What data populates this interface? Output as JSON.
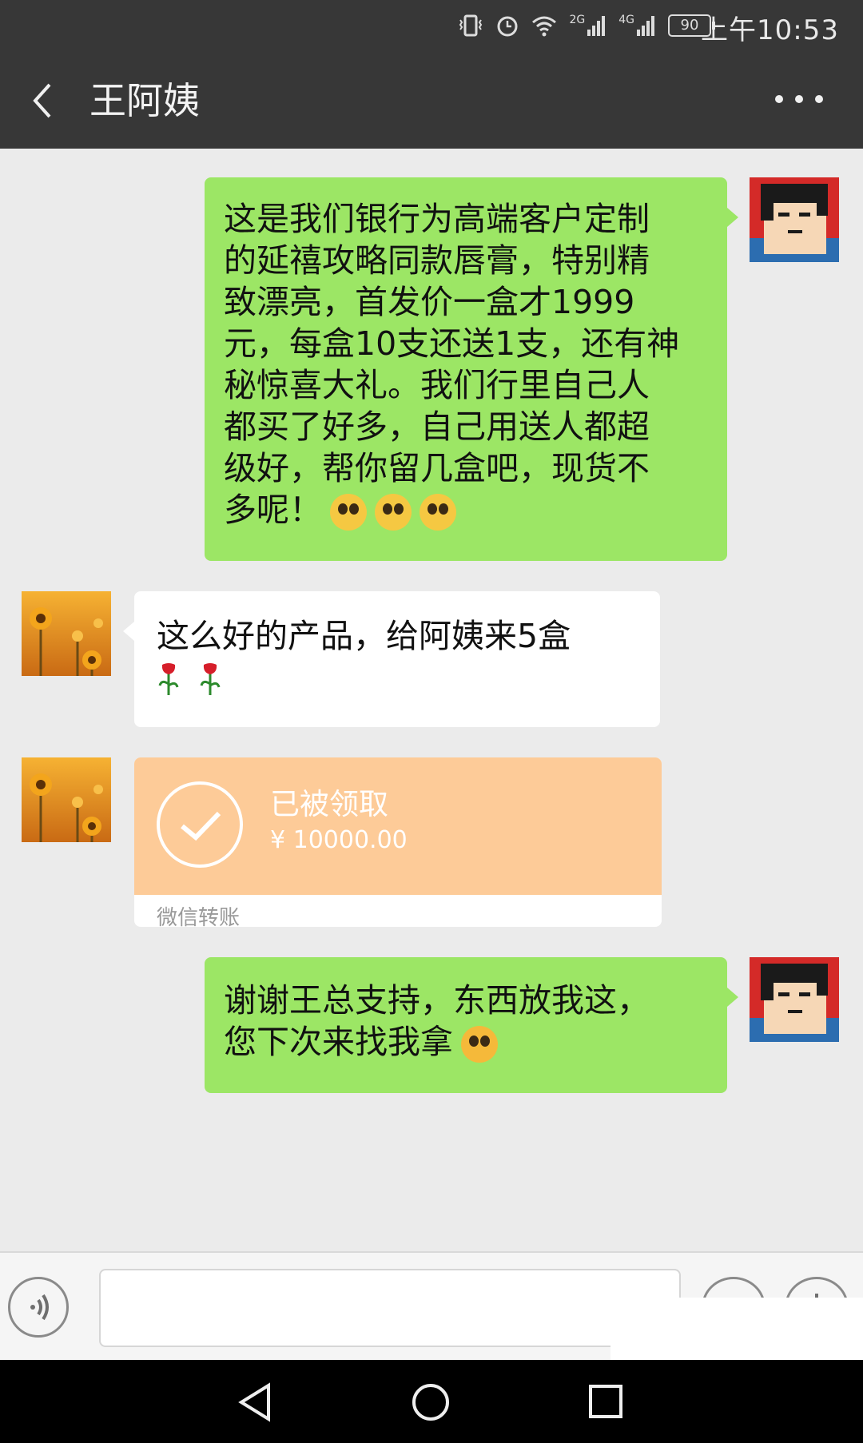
{
  "status_bar": {
    "signal_2g": "2G",
    "signal_4g": "4G",
    "battery": "90",
    "time": "上午10:53"
  },
  "header": {
    "title": "王阿姨"
  },
  "messages": [
    {
      "side": "right",
      "text": "这是我们银行为高端客户定制\n的延禧攻略同款唇膏，特别精\n致漂亮，首发价一盒才1999\n元，每盒10支还送1支，还有神\n秘惊喜大礼。我们行里自己人\n都买了好多，自己用送人都超\n级好，帮你留几盒吧，现货不\n多呢！",
      "emojis": [
        "happy-face-icon",
        "happy-face-icon",
        "happy-face-icon"
      ]
    },
    {
      "side": "left",
      "text": "这么好的产品，给阿姨来5盒",
      "emojis": [
        "rose-icon",
        "rose-icon"
      ]
    },
    {
      "side": "left",
      "type": "transfer",
      "status": "已被领取",
      "amount": "¥ 10000.00",
      "footer": "微信转账"
    },
    {
      "side": "right",
      "text": "谢谢王总支持，东西放我这，\n您下次来找我拿",
      "emojis": [
        "wink-tongue-face-icon"
      ]
    }
  ],
  "colors": {
    "header_bg": "#373737",
    "chat_bg": "#ebebeb",
    "sent_bubble": "#9ce665",
    "received_bubble": "#ffffff",
    "transfer_bubble": "#fdcb98"
  }
}
